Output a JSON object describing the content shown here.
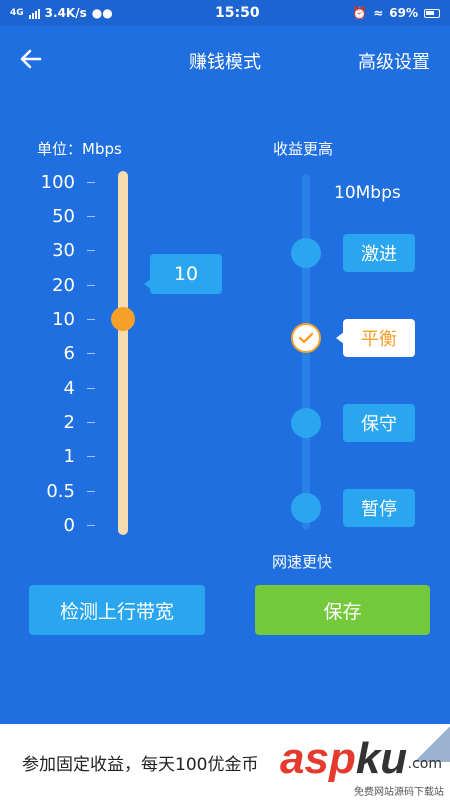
{
  "status_bar": {
    "network": "4G",
    "speed": "3.4K/s",
    "time": "15:50",
    "battery": "69%"
  },
  "header": {
    "title": "赚钱模式",
    "action": "高级设置"
  },
  "bandwidth": {
    "unit_label": "单位：Mbps",
    "ticks": [
      "100",
      "50",
      "30",
      "20",
      "10",
      "6",
      "4",
      "2",
      "1",
      "0.5",
      "0"
    ],
    "selected_value": "10"
  },
  "mode": {
    "top_label": "收益更高",
    "speed_value": "10Mbps",
    "options": [
      "激进",
      "平衡",
      "保守",
      "暂停"
    ],
    "selected": "平衡",
    "bottom_label": "网速更快"
  },
  "buttons": {
    "detect": "检测上行带宽",
    "save": "保存"
  },
  "banner": {
    "text": "参加固定收益，每天100优金币",
    "watermark_brand": "asp",
    "watermark_brand_2": "ku",
    "watermark_domain": ".com",
    "watermark_caption": "免费网站源码下载站"
  }
}
